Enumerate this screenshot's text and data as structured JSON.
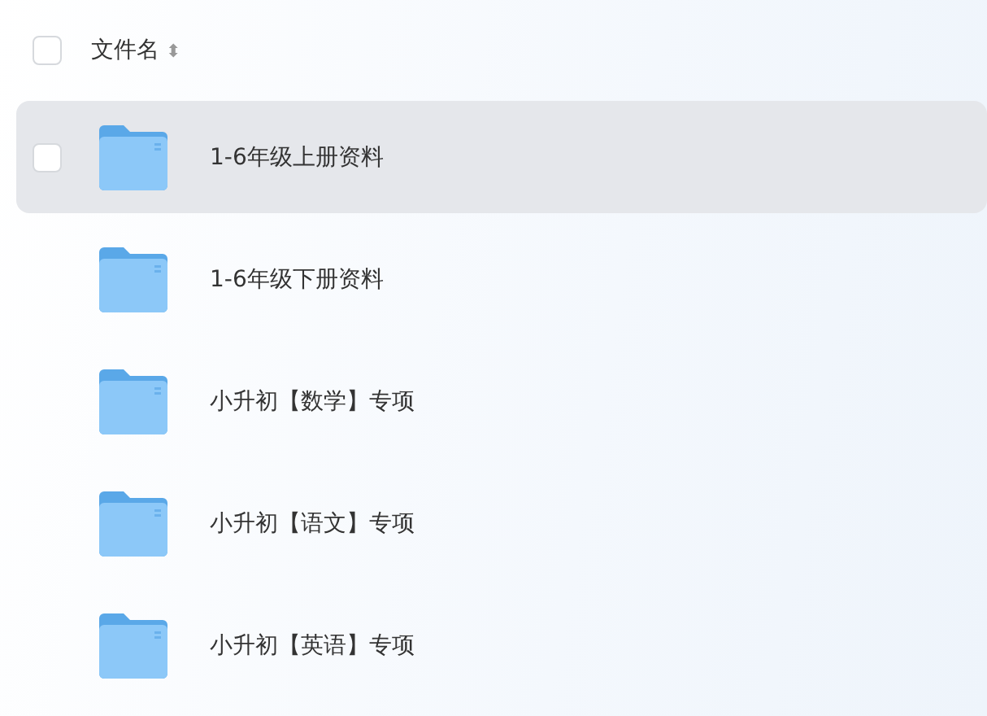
{
  "header": {
    "checked": false,
    "label": "文件名",
    "sort_icon": "⬍"
  },
  "rows": [
    {
      "name": "1-6年级上册资料",
      "hovered": true,
      "checked": false
    },
    {
      "name": "1-6年级下册资料",
      "hovered": false,
      "checked": false
    },
    {
      "name": "小升初【数学】专项",
      "hovered": false,
      "checked": false
    },
    {
      "name": "小升初【语文】专项",
      "hovered": false,
      "checked": false
    },
    {
      "name": "小升初【英语】专项",
      "hovered": false,
      "checked": false
    }
  ]
}
